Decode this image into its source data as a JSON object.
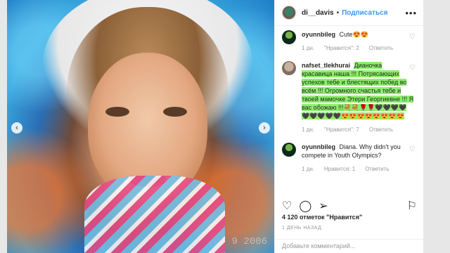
{
  "post": {
    "image_watermark": "9 2006"
  },
  "header": {
    "username": "di__davis",
    "separator": "•",
    "follow_label": "Подписаться",
    "more_icon": "more-dots-icon"
  },
  "comments": [
    {
      "user": "oyunnbileg",
      "text": "Cute😍😍",
      "age": "1 дн.",
      "likes": "\"Нравится\": 2",
      "reply": "Ответить"
    },
    {
      "user": "nafset_tlekhurai",
      "text": "Диaночка красавица наша !!! Потрясающих успехов тебе и блестящих побед во всём !!! Огромного счастья тебе и твоей мамочке Этери Георгиевне !!! Я вас обожаю !!!💐💐🌹🌹🖤🖤🖤🖤🖤🖤🖤🖤🖤😍😍😍😍😍😍😍😍",
      "age": "1 дн.",
      "likes": "\"Нравится\": 7",
      "reply": "Ответить"
    },
    {
      "user": "oyunnbileg",
      "text": "Diana. Why didn't you compete in Youth Olympics?",
      "age": "1 дн.",
      "likes": "Нравится: 1",
      "reply": "Ответить"
    }
  ],
  "actions": {
    "like_icon": "heart-icon",
    "comment_icon": "comment-icon",
    "share_icon": "share-icon",
    "save_icon": "bookmark-icon"
  },
  "likes_count": "4 120 отметок",
  "likes_word": "\"Нравится\"",
  "time_ago": "1 день назад",
  "add_comment_placeholder": "Добавьте комментарий..."
}
